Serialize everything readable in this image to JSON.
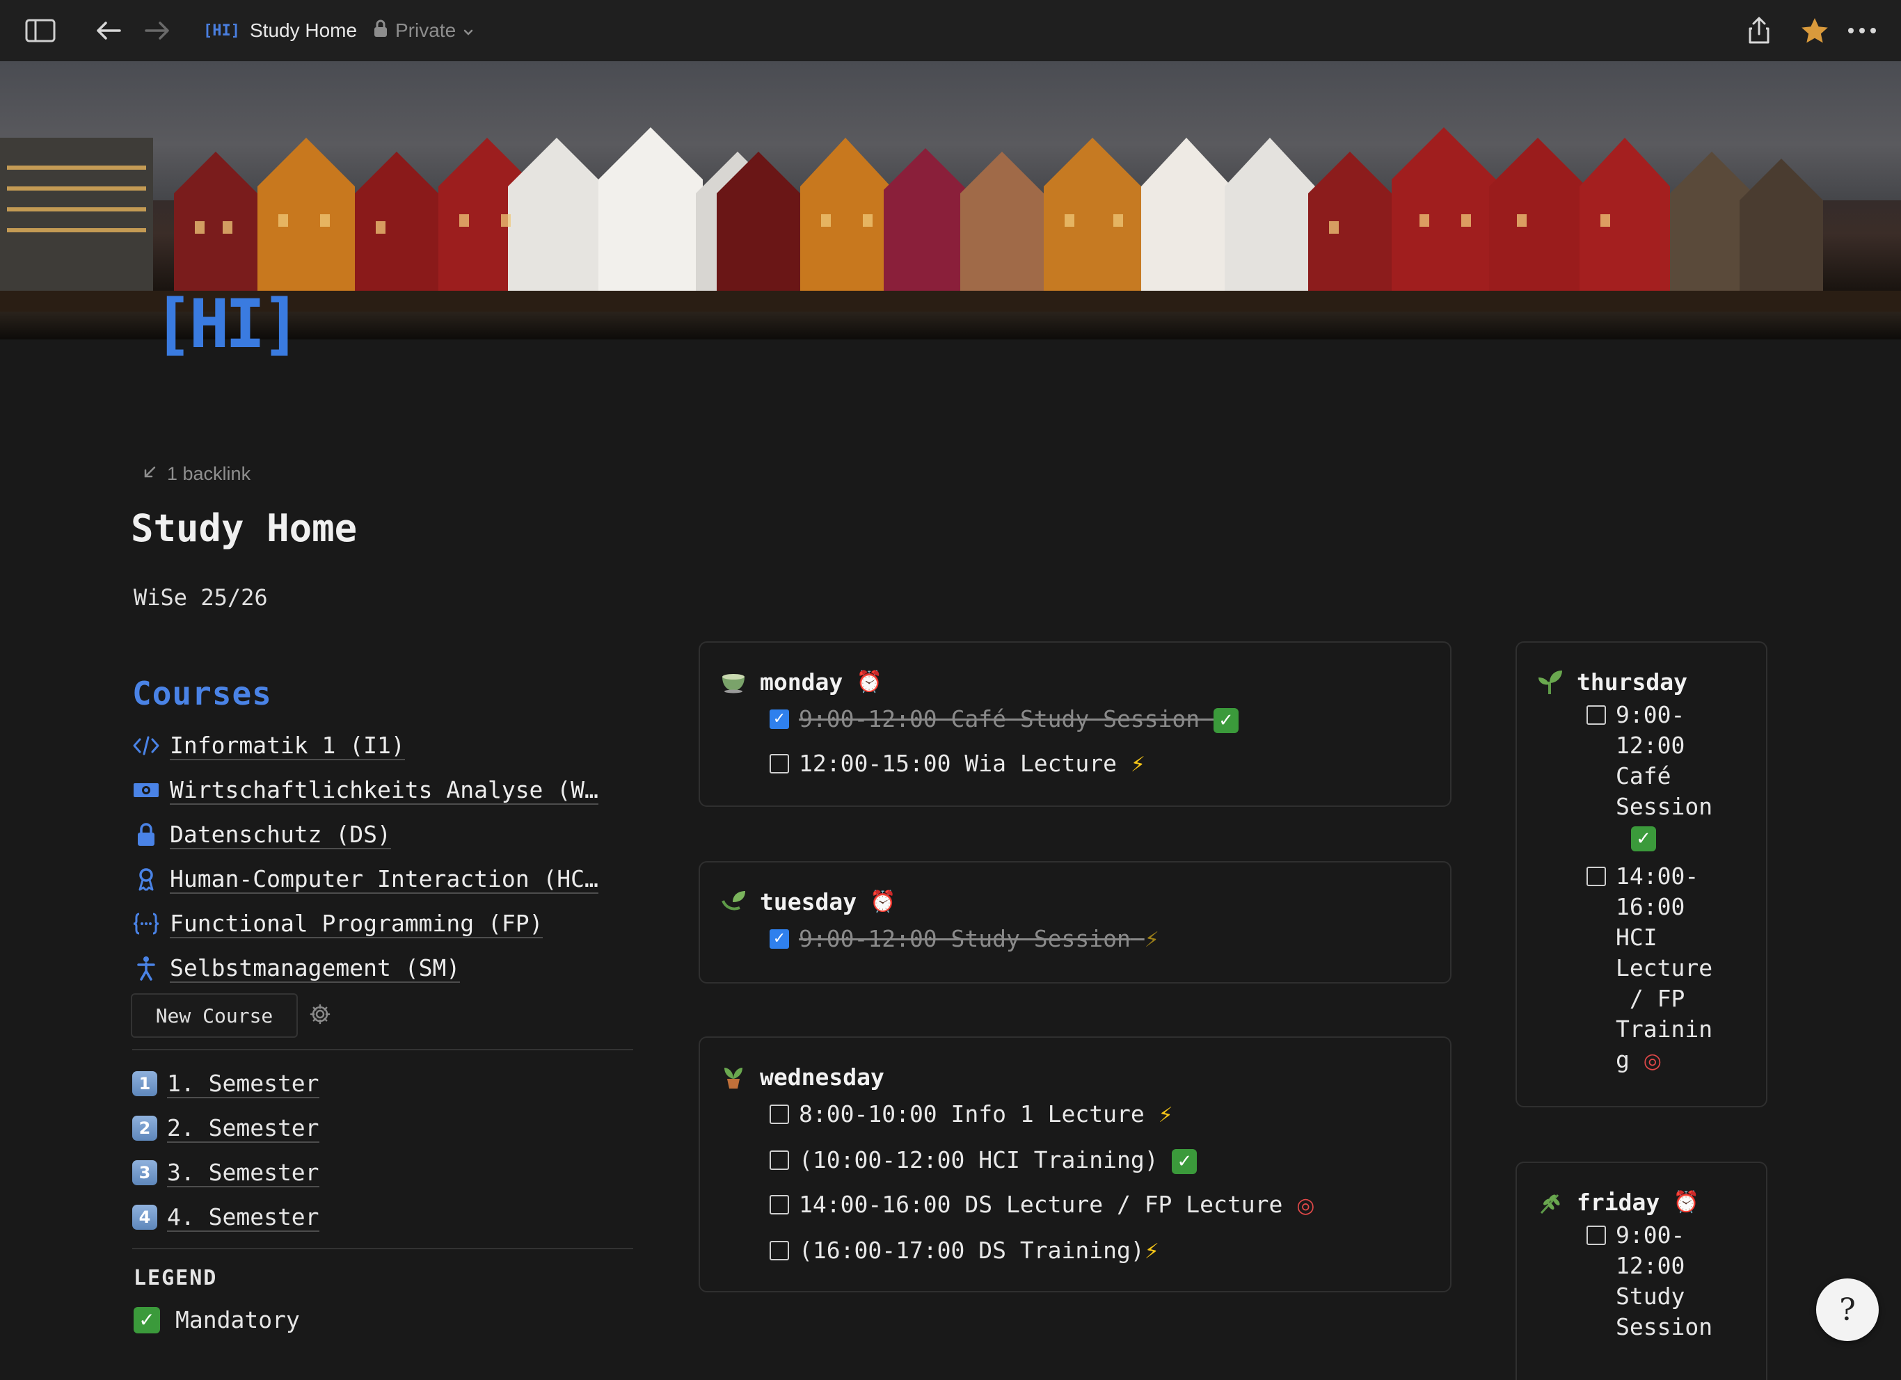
{
  "topbar": {
    "page_icon_glyph": "[HI]",
    "page_name": "Study Home",
    "privacy": "Private"
  },
  "cover": {
    "logo_text": "[HI]"
  },
  "page": {
    "backlinks": "1 backlink",
    "title": "Study Home",
    "subtitle": "WiSe 25/26"
  },
  "courses": {
    "heading": "Courses",
    "items": [
      {
        "label": "Informatik 1 (I1)",
        "icon": "code-icon"
      },
      {
        "label": "Wirtschaftlichkeits Analyse (W…",
        "icon": "money-icon"
      },
      {
        "label": "Datenschutz (DS)",
        "icon": "lock-icon"
      },
      {
        "label": "Human-Computer Interaction (HC…",
        "icon": "ribbon-icon"
      },
      {
        "label": "Functional Programming (FP)",
        "icon": "braces-icon"
      },
      {
        "label": "Selbstmanagement (SM)",
        "icon": "person-icon"
      }
    ],
    "new_button": "New Course"
  },
  "semesters": [
    {
      "key": "1",
      "label": "1. Semester"
    },
    {
      "key": "2",
      "label": "2. Semester"
    },
    {
      "key": "3",
      "label": "3. Semester"
    },
    {
      "key": "4",
      "label": "4. Semester"
    }
  ],
  "legend": {
    "heading": "LEGEND",
    "items": [
      {
        "label": "Mandatory"
      }
    ]
  },
  "days": {
    "monday": {
      "title": "monday",
      "tasks": [
        {
          "text": "9:00-12:00 Café Study Session",
          "checked": true,
          "badge": "check"
        },
        {
          "text": "12:00-15:00 Wia Lecture",
          "checked": false,
          "badge": "bolt"
        }
      ]
    },
    "tuesday": {
      "title": "tuesday",
      "tasks": [
        {
          "text": "9:00-12:00 Study Session",
          "checked": true,
          "badge": "bolt"
        }
      ]
    },
    "wednesday": {
      "title": "wednesday",
      "tasks": [
        {
          "text": "8:00-10:00 Info 1 Lecture",
          "checked": false,
          "badge": "bolt"
        },
        {
          "text": "(10:00-12:00 HCI Training)",
          "checked": false,
          "badge": "check"
        },
        {
          "text": "14:00-16:00 DS Lecture / FP Lecture",
          "checked": false,
          "badge": "target"
        },
        {
          "text": "(16:00-17:00 DS Training)",
          "checked": false,
          "badge": "bolt"
        }
      ]
    },
    "thursday": {
      "title": "thursday",
      "tasks": [
        {
          "lines": [
            "9:00-",
            "12:00",
            "Café",
            "Session"
          ],
          "checked": false,
          "badge": "check"
        },
        {
          "lines": [
            "14:00-",
            "16:00",
            "HCI",
            "Lecture",
            " / FP",
            "Trainin",
            "g"
          ],
          "checked": false,
          "badge": "target"
        }
      ]
    },
    "friday": {
      "title": "friday",
      "tasks": [
        {
          "lines": [
            "9:00-",
            "12:00",
            "Study",
            "Session"
          ],
          "checked": false
        }
      ]
    }
  },
  "colors": {
    "accent": "#4a83e6",
    "checkbox_checked": "#2f80ed",
    "success": "#3b9a3b",
    "background": "#191919"
  }
}
